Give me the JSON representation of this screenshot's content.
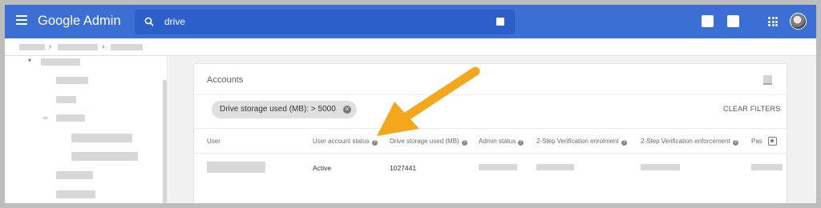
{
  "app": {
    "title": "Google Admin"
  },
  "search": {
    "value": "drive"
  },
  "accounts": {
    "title": "Accounts",
    "filter_chip": "Drive storage used (MB): > 5000",
    "clear_filters": "CLEAR FILTERS",
    "columns": [
      "User",
      "User account status",
      "Drive storage used (MB)",
      "Admin status",
      "2-Step Verification enrolment",
      "2-Step Verification enforcement",
      "Pas"
    ],
    "rows": [
      {
        "status": "Active",
        "drive_storage": "1027441"
      }
    ]
  },
  "colors": {
    "topbar": "#3b6fd4",
    "arrow": "#f3a81b"
  },
  "icons": [
    "menu-icon",
    "search-icon",
    "apps-icon",
    "avatar",
    "help-icon",
    "close-icon",
    "column-settings-icon",
    "annotation-arrow"
  ]
}
